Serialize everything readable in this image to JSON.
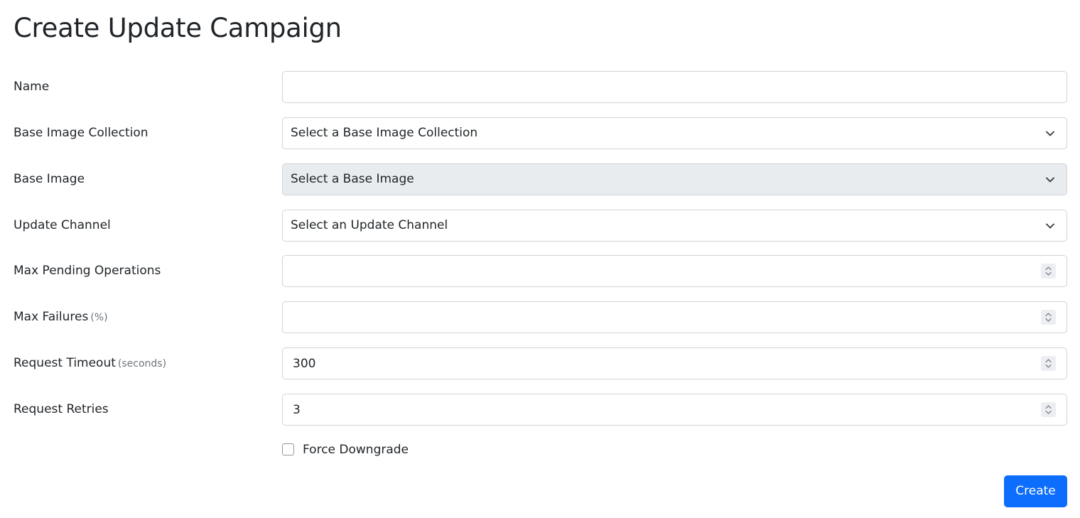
{
  "page": {
    "title": "Create Update Campaign"
  },
  "form": {
    "name": {
      "label": "Name",
      "value": ""
    },
    "base_image_collection": {
      "label": "Base Image Collection",
      "selected": "Select a Base Image Collection"
    },
    "base_image": {
      "label": "Base Image",
      "selected": "Select a Base Image",
      "disabled": true
    },
    "update_channel": {
      "label": "Update Channel",
      "selected": "Select an Update Channel"
    },
    "max_pending_operations": {
      "label": "Max Pending Operations",
      "value": ""
    },
    "max_failures": {
      "label": "Max Failures",
      "unit": "(%)",
      "value": ""
    },
    "request_timeout": {
      "label": "Request Timeout",
      "unit": "(seconds)",
      "value": "300"
    },
    "request_retries": {
      "label": "Request Retries",
      "value": "3"
    },
    "force_downgrade": {
      "label": "Force Downgrade",
      "checked": false
    },
    "submit_label": "Create"
  },
  "colors": {
    "primary": "#0d6efd",
    "text": "#212529",
    "muted": "#6c757d",
    "border": "#ced4da",
    "disabled_bg": "#e9ecef"
  },
  "icons": {
    "select_arrow": "chevron-down-icon",
    "number_spinner": "spinner-arrows-icon"
  }
}
